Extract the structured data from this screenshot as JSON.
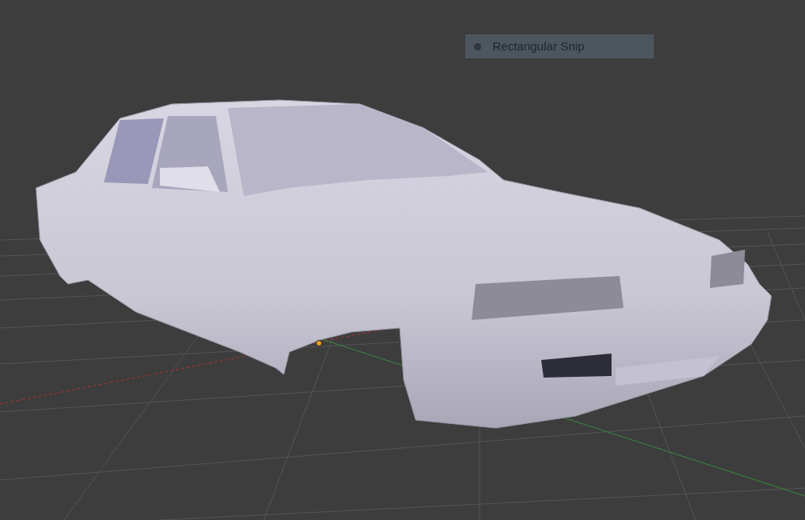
{
  "viewport": {
    "tooltip": {
      "label": "Rectangular Snip"
    }
  }
}
